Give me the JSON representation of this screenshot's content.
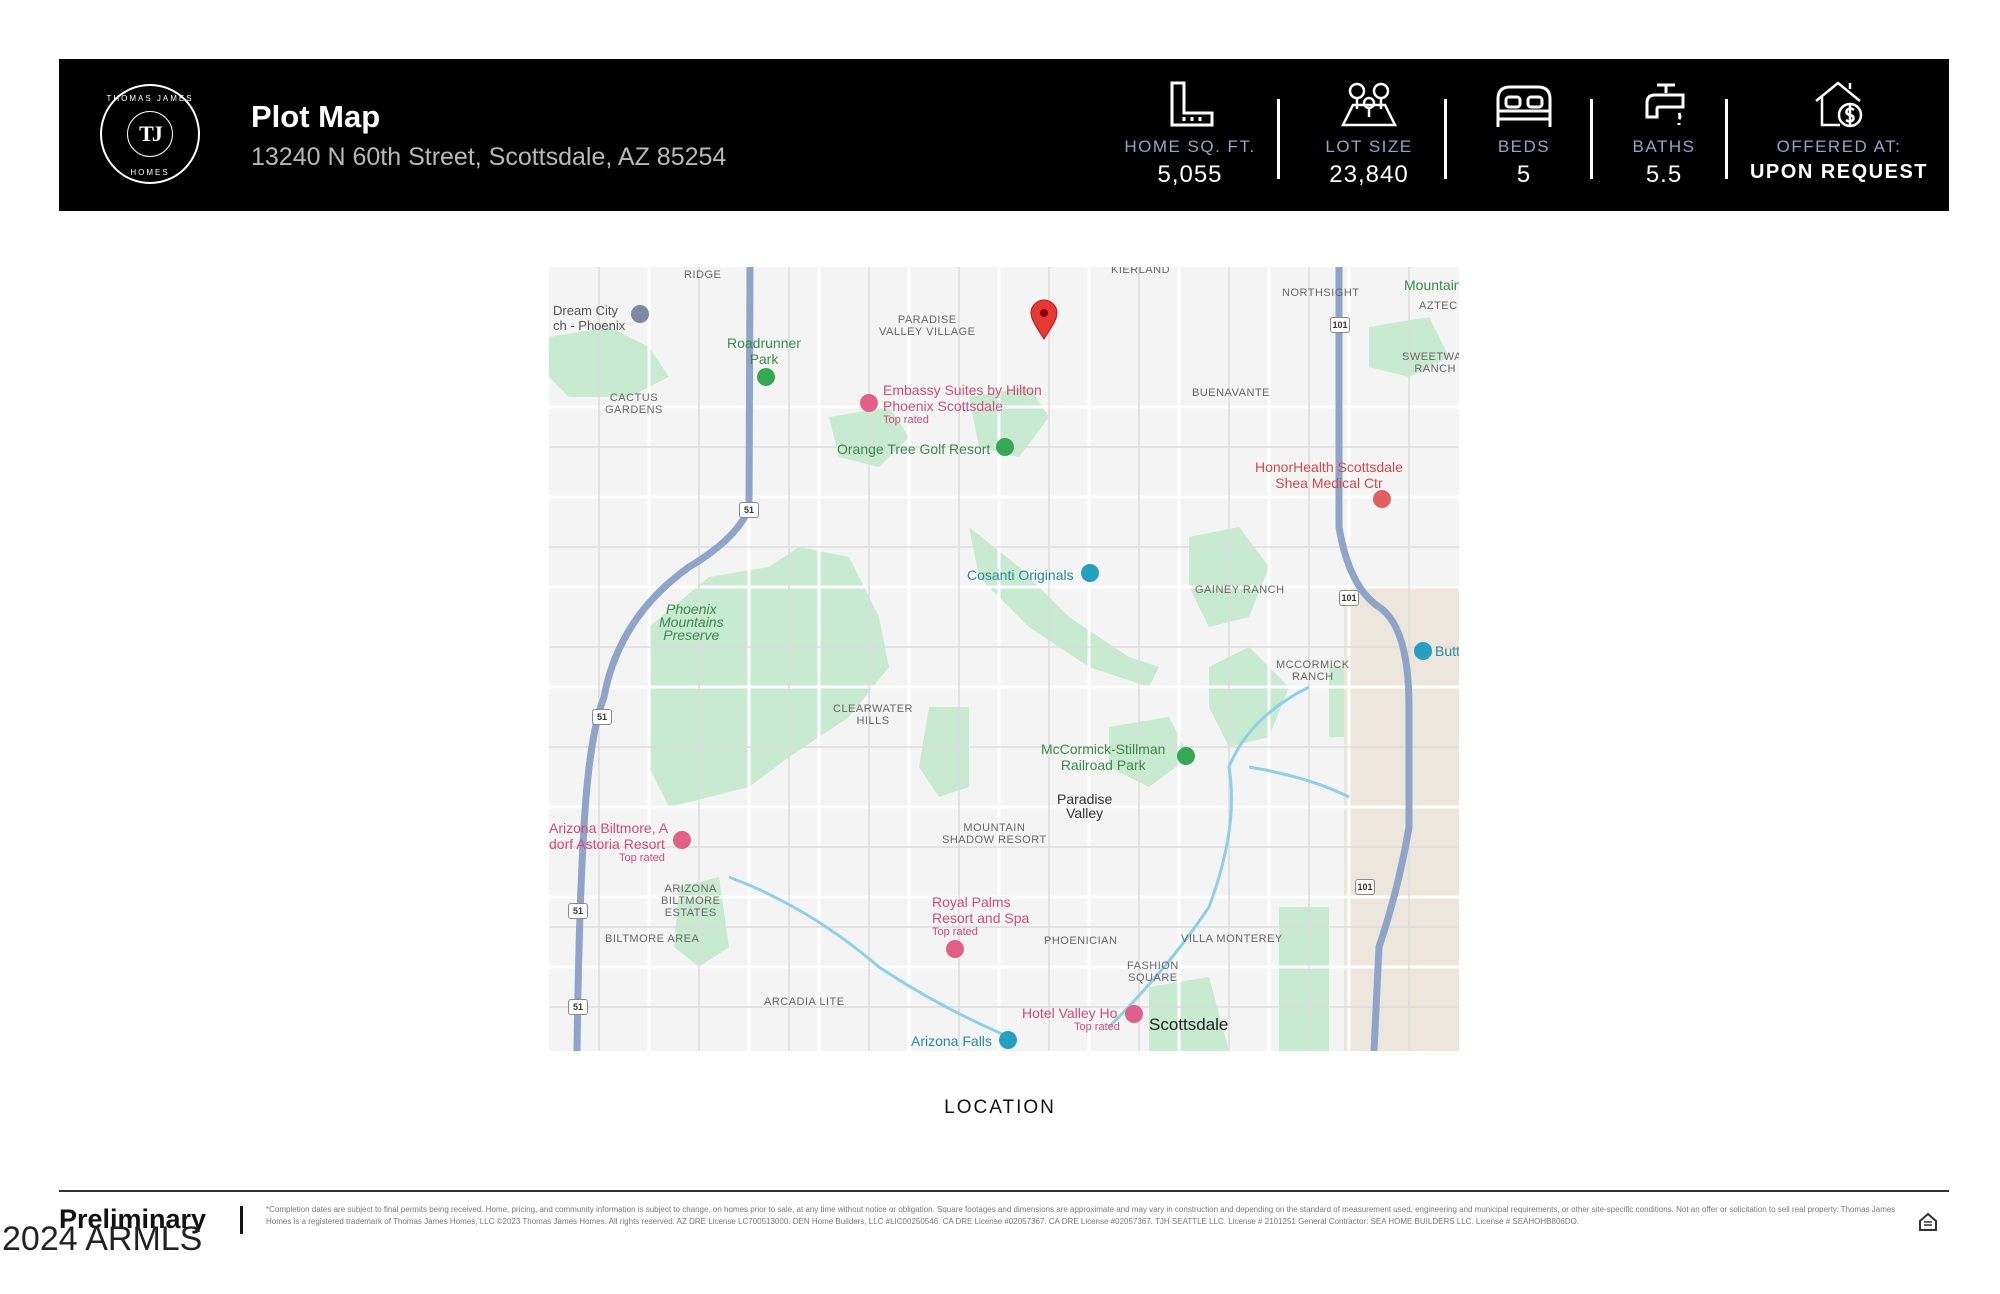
{
  "header": {
    "logo_text": "TJ",
    "logo_top": "THOMAS JAMES",
    "logo_bottom": "HOMES",
    "title": "Plot Map",
    "address": "13240 N 60th Street, Scottsdale, AZ 85254",
    "stats": [
      {
        "icon": "ruler-square-icon",
        "label": "HOME SQ. FT.",
        "value": "5,055"
      },
      {
        "icon": "lot-trees-icon",
        "label": "LOT SIZE",
        "value": "23,840"
      },
      {
        "icon": "bed-icon",
        "label": "BEDS",
        "value": "5"
      },
      {
        "icon": "faucet-icon",
        "label": "BATHS",
        "value": "5.5"
      },
      {
        "icon": "house-dollar-icon",
        "label": "OFFERED AT:",
        "value": "UPON REQUEST"
      }
    ]
  },
  "map": {
    "labels": {
      "ridge": "RIDGE",
      "kierland": "KIERLAND",
      "mountain": "Mountain",
      "dream_city": "Dream City\nch - Phoenix",
      "paradise_valley_village": "PARADISE\nVALLEY VILLAGE",
      "northsight": "NORTHSIGHT",
      "aztec": "AZTEC",
      "roadrunner": "Roadrunner\nPark",
      "sweetwater": "SWEETWAT\nRANCH",
      "cactus": "CACTUS\nGARDENS",
      "embassy": "Embassy Suites by Hilton\nPhoenix Scottsdale",
      "embassy_sub": "Top rated",
      "buenavante": "BUENAVANTE",
      "orange_tree": "Orange Tree Golf Resort",
      "honorhealth": "HonorHealth Scottsdale\nShea Medical Ctr",
      "cosanti": "Cosanti Originals",
      "gainey": "GAINEY RANCH",
      "phoenix_mtns": "Phoenix\nMountains\nPreserve",
      "butt": "Butt",
      "mccormick_ranch": "MCCORMICK\nRANCH",
      "clearwater": "CLEARWATER\nHILLS",
      "mccormick_stillman": "McCormick-Stillman\nRailroad Park",
      "paradise_valley": "Paradise\nValley",
      "mountain_shadow": "MOUNTAIN\nSHADOW RESORT",
      "biltmore": "Arizona Biltmore, A\ndorf Astoria Resort",
      "biltmore_sub": "Top rated",
      "biltmore_estates": "ARIZONA\nBILTMORE\nESTATES",
      "royal_palms": "Royal Palms\nResort and Spa",
      "royal_palms_sub": "Top rated",
      "phoenician": "PHOENICIAN",
      "villa_monterey": "VILLA MONTEREY",
      "biltmore_area": "BILTMORE AREA",
      "fashion_square": "FASHION\nSQUARE",
      "arcadia": "ARCADIA LITE",
      "hotel_valley_ho": "Hotel Valley Ho",
      "hotel_sub": "Top rated",
      "scottsdale": "Scottsdale",
      "arizona_falls": "Arizona Falls"
    },
    "shields": {
      "s51": "51",
      "s101": "101"
    }
  },
  "caption": "LOCATION",
  "footer": {
    "preliminary": "Preliminary",
    "copyright": "2024 ARMLS",
    "disclaimer": "*Completion dates are subject to final permits being received. Home, pricing, and community information is subject to change, on homes prior to sale, at any time without notice or obligation. Square footages and dimensions are approximate and may vary in construction and depending on the standard of measurement used, engineering and municipal requirements, or other site-specific conditions. Not an offer or solicitation to sell real property. Thomas James Homes is a registered trademark of Thomas James Homes, LLC ©2023 Thomas James Homes. All rights reserved. AZ DRE License LC700513000. DEN Home Builders, LLC #LIC00250546. CA DRE License #02057367. CA DRE License #02057367. TJH SEATTLE LLC. License # 2101251 General Contractor: SEA HOME BUILDERS LLC. License # SEAHOHB806DO."
  },
  "colors": {
    "header_bg": "#000000",
    "stat_label": "#8fa8c0",
    "park": "#c7ead0",
    "highway": "#8ea4c8",
    "pin": "#e53935"
  }
}
